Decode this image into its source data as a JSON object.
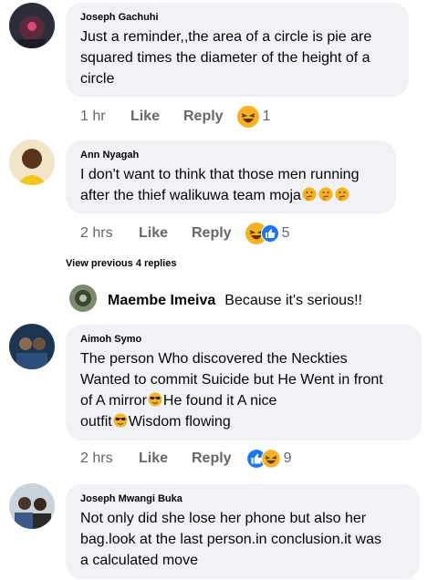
{
  "comments": [
    {
      "author": "Joseph Gachuhi",
      "lines": [
        "Just a reminder,,the area of a circle is pie are",
        "squared times the diameter of the height of a",
        "circle"
      ],
      "time": "1 hr",
      "like": "Like",
      "reply": "Reply",
      "reactions": [
        "haha-icon"
      ],
      "reaction_count": "1"
    },
    {
      "author": "Ann Nyagah",
      "lines": [
        "I don't want to think that those men running",
        "after the thief walikuwa team moja"
      ],
      "trailing_emoji": "thinking-face-emoji",
      "time": "2 hrs",
      "like": "Like",
      "reply": "Reply",
      "reactions": [
        "haha-icon",
        "like-icon"
      ],
      "reaction_count": "5"
    },
    {
      "author": "Aimoh Symo",
      "lines": [
        "The person Who discovered the Neckties",
        "Wanted to commit Suicide but He Went in front",
        "of A mirror",
        "He found it A nice",
        "outfit",
        "Wisdom flowing"
      ],
      "time": "2 hrs",
      "like": "Like",
      "reply": "Reply",
      "reactions": [
        "like-icon",
        "haha-icon"
      ],
      "reaction_count": "9"
    },
    {
      "author": "Joseph Mwangi Buka",
      "lines": [
        "Not only did she lose her phone but also her",
        "bag.look at the last person.in conclusion.it was",
        "a calculated move"
      ]
    }
  ],
  "view_previous": "View previous 4 replies",
  "inline_reply": {
    "author": "Maembe Imeiva",
    "text": "Because it's serious!!"
  },
  "colors": {
    "bubble": "#f0f2f5",
    "meta_text": "#65676b",
    "like_blue": "#1877f2",
    "haha_yellow": "#f7b125"
  }
}
